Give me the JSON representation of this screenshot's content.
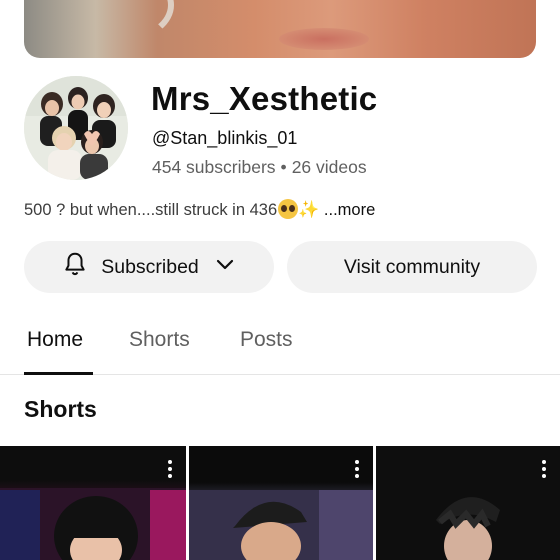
{
  "channel": {
    "name": "Mrs_Xesthetic",
    "handle": "@Stan_blinkis_01",
    "subscribers": "454 subscribers",
    "separator": "•",
    "videos": "26 videos",
    "description": "500 ? but when....still struck in 436",
    "more_label": "...more"
  },
  "actions": {
    "subscribe_label": "Subscribed",
    "community_label": "Visit community"
  },
  "tabs": [
    {
      "label": "Home",
      "active": true
    },
    {
      "label": "Shorts",
      "active": false
    },
    {
      "label": "Posts",
      "active": false
    }
  ],
  "shorts_section": {
    "title": "Shorts",
    "items": [
      {
        "icon": "more-vert-icon"
      },
      {
        "icon": "more-vert-icon"
      },
      {
        "icon": "more-vert-icon"
      }
    ]
  },
  "colors": {
    "button_bg": "#f2f2f2",
    "text_primary": "#0f0f0f",
    "text_secondary": "#606060"
  }
}
